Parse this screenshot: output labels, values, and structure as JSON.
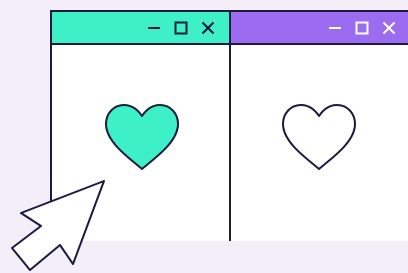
{
  "colors": {
    "background": "#f3eef7",
    "outline": "#1b1a3f",
    "left_titlebar": "#3ef0c6",
    "right_titlebar": "#9b6cf0",
    "window_body": "#ffffff",
    "filled_heart": "#3ef0c6",
    "cursor_fill": "#ffffff"
  },
  "windows": [
    {
      "id": "left",
      "controls": [
        "minimize-icon",
        "maximize-icon",
        "close-icon"
      ],
      "heart": "filled-heart-icon",
      "state": "active"
    },
    {
      "id": "right",
      "controls": [
        "minimize-icon",
        "maximize-icon",
        "close-icon"
      ],
      "heart": "outline-heart-icon",
      "state": "inactive"
    }
  ],
  "cursor": "pointer-arrow-icon"
}
